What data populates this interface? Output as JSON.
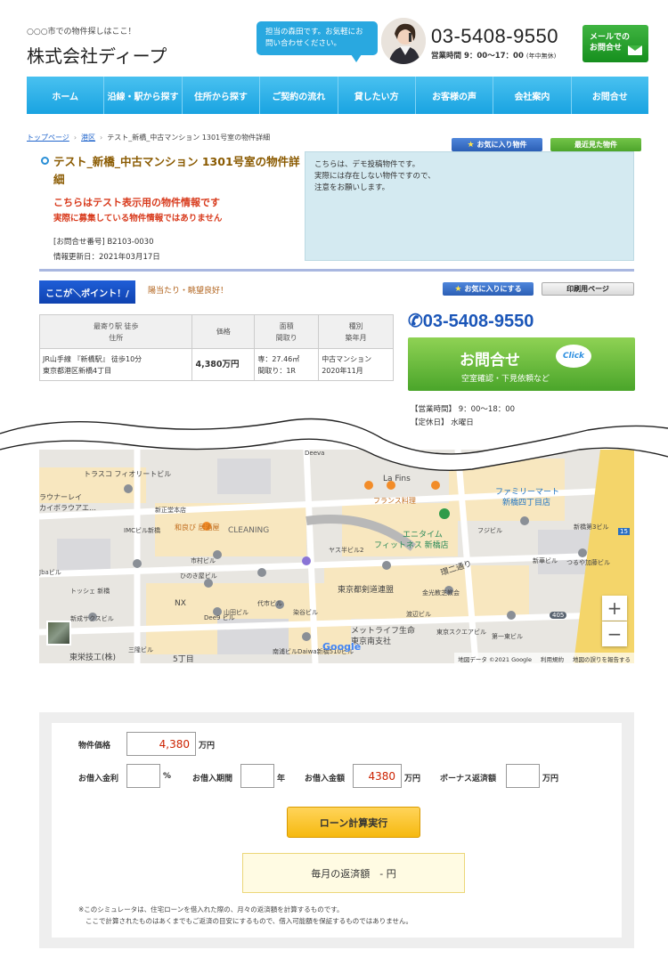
{
  "header": {
    "tagline": "○○○市での物件探しはここ！",
    "company": "株式会社ディープ",
    "bubble": "担当の森田です。お気軽にお問い合わせください。",
    "phone": "03-5408-9550",
    "hours_label": "営業時間 9：00～17：00",
    "hours_note": "(年中無休)",
    "mail_button": "メールでのお問合せ"
  },
  "nav": [
    "ホーム",
    "沿線・駅から探す",
    "住所から探す",
    "ご契約の流れ",
    "貸したい方",
    "お客様の声",
    "会社案内",
    "お問合せ"
  ],
  "breadcrumb": {
    "home": "トップページ",
    "area": "港区",
    "current": "テスト_新橋_中古マンション 1301号室の物件詳細"
  },
  "buttons": {
    "favorites": "お気に入り物件",
    "recent": "最近見た物件",
    "add_favorite": "お気に入りにする",
    "print": "印刷用ページ"
  },
  "property": {
    "title": "テスト_新橋_中古マンション 1301号室の物件詳細",
    "warning1": "こちらはテスト表示用の物件情報です",
    "warning2": "実際に募集している物件情報ではありません",
    "inquiry_no": "[お問合せ番号] B2103-0030",
    "updated": "情報更新日：2021年03月17日"
  },
  "notice": {
    "line1": "こちらは、デモ投稿物件です。",
    "line2": "実際には存在しない物件ですので、",
    "line3": "注意をお願いします。"
  },
  "point": {
    "tag": "ここが＼ポイント！/",
    "text": "陽当たり・眺望良好！"
  },
  "summary": {
    "headers": {
      "station": "最寄り駅 徒歩",
      "address": "住所",
      "price": "価格",
      "area": "面積",
      "layout": "間取り",
      "type": "種別",
      "built": "築年月"
    },
    "row": {
      "station": "JR山手線 『新橋駅』 徒歩10分",
      "address": "東京都港区新橋4丁目",
      "price": "4,380万円",
      "area": "専：27.46㎡",
      "layout": "間取り：1R",
      "type": "中古マンション",
      "built": "2020年11月"
    }
  },
  "contact": {
    "phone": "03-5408-9550",
    "button_main": "お問合せ",
    "button_sub": "空室確認・下見依頼など",
    "click": "Click",
    "open_hours": "【営業時間】 9：00～18：00",
    "closed": "【定休日】 水曜日"
  },
  "map": {
    "labels": [
      "トラスコ フィオリートビル",
      "ラウナーレイ",
      "カイボラウアエ…",
      "新正堂本店",
      "IMCビル新橋",
      "和良び 居酒屋",
      "CLEANING",
      "市村ビル",
      "ひのき屋ビル",
      "NX",
      "Dee9 ビル",
      "山田ビル",
      "新成サクスビル",
      "トッシェ 新橋",
      "東栄技工(株)",
      "三隆ビル",
      "5丁目",
      "La Fins",
      "フランス料理",
      "エニタイム",
      "フィットネス 新橋店",
      "ファミリーマート",
      "新橋四丁目店",
      "新橋第3ビル",
      "ヤス半ビル2",
      "環二通り",
      "東京都剣道連盟",
      "金光教芝教会",
      "メットライフ生命",
      "東京南支社",
      "東京スクエアビル",
      "第一東ビル",
      "つるや加藤ビル",
      "代市ビル",
      "染谷ビル",
      "渡辺ビル",
      "Daiwa新橋510ビル",
      "南浦ビル",
      "Deeva",
      "Jbaビル",
      "フジビル",
      "新華ビル",
      "405",
      "15"
    ],
    "google": "Google",
    "copyright": "地図データ ©2021 Google",
    "terms": "利用規約",
    "report": "地図の誤りを報告する"
  },
  "loan": {
    "price_label": "物件価格",
    "price_value": "4,380",
    "price_unit": "万円",
    "rate_label": "お借入金利",
    "rate_unit": "%",
    "period_label": "お借入期間",
    "period_unit": "年",
    "amount_label": "お借入金額",
    "amount_value": "4380",
    "amount_unit": "万円",
    "bonus_label": "ボーナス返済額",
    "bonus_unit": "万円",
    "calc_button": "ローン計算実行",
    "result": "毎月の返済額　- 円",
    "note1": "※このシミュレータは、住宅ローンを借入れた際の、月々の返済額を計算するものです。",
    "note2": "ここで計算されたものはあくまでもご返済の目安にするもので、借入可能額を保証するものではありません。"
  },
  "colors": {
    "nav": "#29abe2",
    "accent_green": "#4aa52a",
    "title_brown": "#8a5a00",
    "warning_red": "#d83a1c",
    "phone_blue": "#1b56b8"
  }
}
